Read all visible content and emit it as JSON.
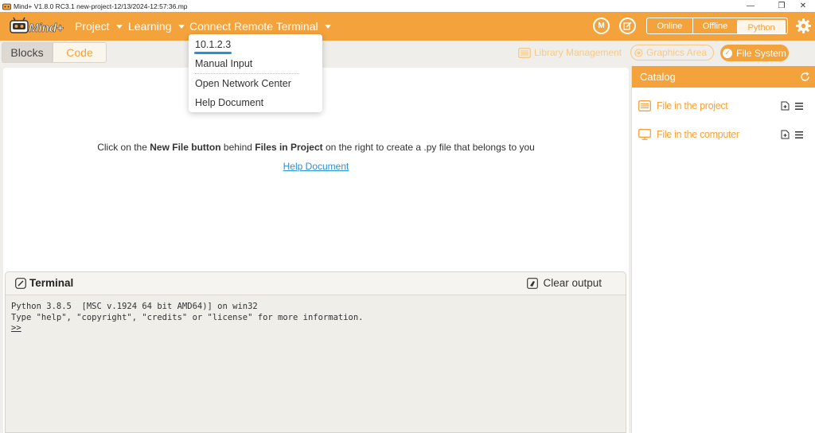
{
  "window": {
    "title": "Mind+ V1.8.0 RC3.1   new-project-12/13/2024-12:57:36.mp",
    "minimize": "—",
    "restore": "❐",
    "close": "✕"
  },
  "menubar": {
    "project": "Project",
    "learning": "Learning",
    "connect": "Connect Remote Terminal",
    "modes": {
      "online": "Online",
      "offline": "Offline",
      "python": "Python"
    }
  },
  "toolbar": {
    "tab_blocks": "Blocks",
    "tab_code": "Code",
    "library_management": "Library Management",
    "graphics_area": "Graphics Area",
    "file_system": "File System"
  },
  "dropdown": {
    "items": [
      "10.1.2.3",
      "Manual Input",
      "Open Network Center",
      "Help Document"
    ]
  },
  "editor": {
    "hint_pre": "Click on the ",
    "hint_b1": "New File button",
    "hint_mid": " behind ",
    "hint_b2": "Files in Project",
    "hint_post": " on the right to create a .py file that belongs to you",
    "help_link": "Help Document"
  },
  "terminal": {
    "title": "Terminal",
    "clear": "Clear output",
    "line1": "Python 3.8.5  [MSC v.1924 64 bit AMD64)] on win32",
    "line2": "Type \"help\", \"copyright\", \"credits\" or \"license\" for more information.",
    "prompt": ">>"
  },
  "sidebar": {
    "catalog": "Catalog",
    "items": [
      "File in the project",
      "File in the computer"
    ]
  },
  "colors": {
    "accent": "#f4a33c",
    "link": "#2b8fd6"
  }
}
